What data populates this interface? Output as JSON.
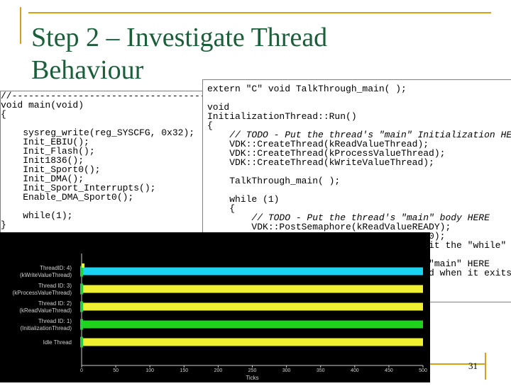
{
  "slide": {
    "title_line1": "Step 2 – Investigate Thread",
    "title_line2": "Behaviour",
    "page_number": "31"
  },
  "left_code": [
    "//--------------------------------------------------",
    "void main(void)",
    "{",
    "",
    "    sysreg_write(reg_SYSCFG, 0x32);",
    "    Init_EBIU();",
    "    Init_Flash();",
    "    Init1836();",
    "    Init_Sport0();",
    "    Init_DMA();",
    "    Init_Sport_Interrupts();",
    "    Enable_DMA_Sport0();",
    "",
    "    while(1);",
    "}"
  ],
  "right_code": [
    "extern \"C\" void TalkThrough_main( );",
    "",
    "void",
    "InitializationThread::Run()",
    "{",
    "    // TODO - Put the thread's \"main\" Initialization HERE",
    "    VDK::CreateThread(kReadValueThread);",
    "    VDK::CreateThread(kProcessValueThread);",
    "    VDK::CreateThread(kWriteValueThread);",
    "",
    "    TalkThrough_main( );",
    "",
    "    while (1)",
    "    {",
    "        // TODO - Put the thread's \"main\" body HERE",
    "        VDK::PostSemaphore(kReadValueREADY);",
    "                                     R, 0);",
    "                                      exit the \"while\"",
    "",
    "                                      n \"main\" HERE",
    "                                      yed when it exits"
  ],
  "chart_data": {
    "type": "timeline",
    "xlabel": "Ticks",
    "xlim": [
      0,
      500
    ],
    "x_ticks": [
      "0",
      "50",
      "100",
      "150",
      "200",
      "250",
      "300",
      "350",
      "400",
      "450",
      "500"
    ],
    "threads": [
      {
        "label1": "ThreadID: 4)",
        "label2": "(kWriteValueThread)",
        "color": "#19d4f0",
        "start": 0,
        "end": 500
      },
      {
        "label1": "Thread ID: 3)",
        "label2": "(kProcessValueThread)",
        "color": "#f0f032",
        "start": 0,
        "end": 500
      },
      {
        "label1": "Thread ID: 2)",
        "label2": "(kReadValueThread)",
        "color": "#f0f032",
        "start": 0,
        "end": 500
      },
      {
        "label1": "Thread ID: 1)",
        "label2": "(InitializationThread)",
        "color": "#1ed21e",
        "start": 0,
        "end": 500
      },
      {
        "label1": "Idle Thread",
        "label2": "",
        "color": "#f0f032",
        "start": 0,
        "end": 500
      }
    ]
  }
}
